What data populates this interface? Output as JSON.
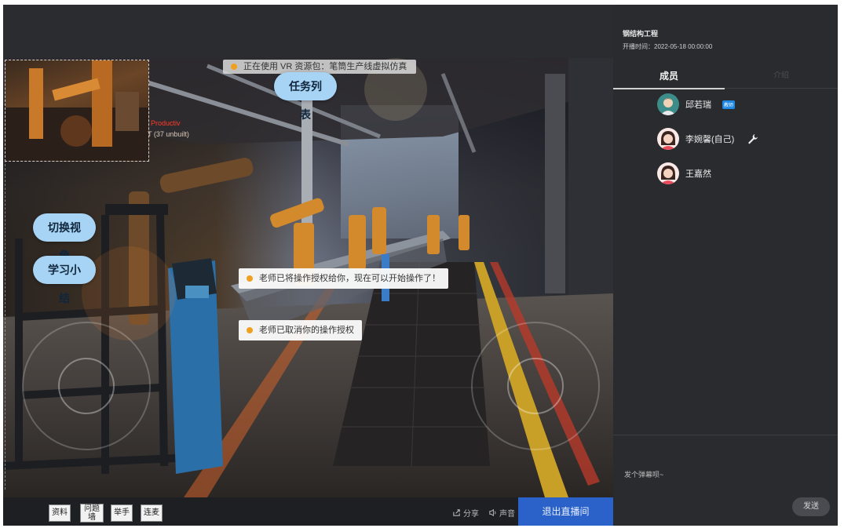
{
  "notice": {
    "vr_resource": "正在使用 VR 资源包：笔筒生产线虚拟仿真"
  },
  "scene": {
    "thumb_text_red": "Productiv",
    "thumb_text": "T (37 unbuilt)"
  },
  "buttons": {
    "task_list": "任务列表",
    "switch_view": "切换视角",
    "study_summary": "学习小结"
  },
  "toasts": {
    "granted": "老师已将操作授权给你，现在可以开始操作了！",
    "revoked": "老师已取消你的操作授权"
  },
  "toolbar": {
    "materials": "资料",
    "question_wall": "问题墙",
    "raise_hand": "举手",
    "connect_mic": "连麦",
    "share": "分享",
    "sound": "声音",
    "exit_live": "退出直播间"
  },
  "sidebar": {
    "title": "钢结构工程",
    "start_time": "开播时间：2022-05-18 00:00:00",
    "tabs": [
      {
        "label": "成员"
      },
      {
        "label": "介绍"
      }
    ],
    "members": [
      {
        "name": "邱若瑞",
        "badge": "教师"
      },
      {
        "name": "李婉馨(自己)",
        "badge": ""
      },
      {
        "name": "王嘉然",
        "badge": ""
      }
    ],
    "chat_placeholder": "发个弹幕呗~",
    "send_label": "发送"
  },
  "colors": {
    "accent_blue": "#2a62c9",
    "pill_blue": "#a7d4f4",
    "notice_dot": "#f0a020",
    "panel_bg": "#2a2b2e",
    "badge_blue": "#1e88e5"
  },
  "icons": {
    "share": "share-icon",
    "sound": "speaker-icon",
    "wrench": "wrench-icon",
    "dot": "status-dot-icon"
  }
}
